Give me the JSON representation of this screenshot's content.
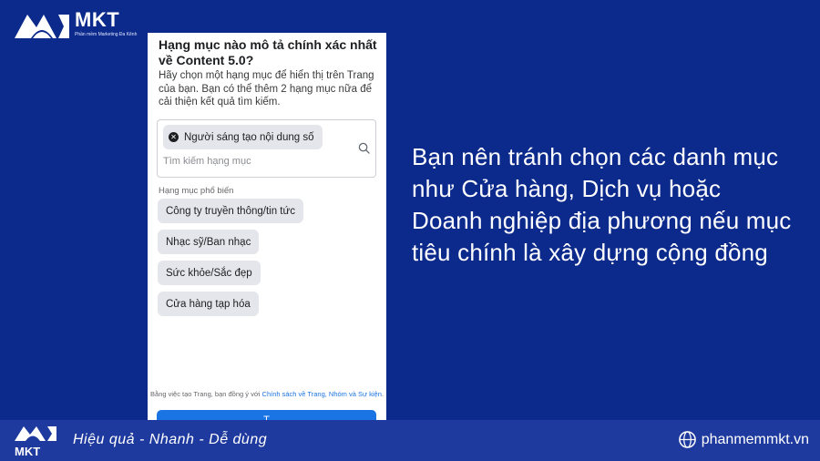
{
  "logo": {
    "brand": "MKT",
    "tagline": "Phần mềm Marketing Đa Kênh"
  },
  "panel": {
    "title": "Hạng mục nào mô tả chính xác nhất về Content 5.0?",
    "description": "Hãy chọn một hạng mục để hiển thị trên Trang của bạn. Bạn có thể thêm 2 hạng mục nữa để cải thiện kết quả tìm kiếm.",
    "selected_chip": "Người sáng tạo nội dung số",
    "search_placeholder": "Tìm kiếm hạng mục",
    "popular_title": "Hạng mục phổ biến",
    "categories": [
      "Công ty truyền thông/tin tức",
      "Nhạc sỹ/Ban nhạc",
      "Sức khỏe/Sắc đẹp",
      "Cửa hàng tạp hóa"
    ],
    "terms_prefix": "Bằng việc tạo Trang, bạn đồng ý với ",
    "terms_link": "Chính sách về Trang, Nhóm và Sự kiện",
    "terms_suffix": ".",
    "cta_label": "T"
  },
  "message": "Bạn nên tránh chọn các danh mục như Cửa hàng, Dịch vụ hoặc Doanh nghiệp địa phương nếu mục tiêu chính là xây dựng cộng đồng",
  "footer": {
    "slogan": "Hiệu quả - Nhanh  - Dễ dùng",
    "website": "phanmemmkt.vn",
    "bottom_brand": "MKT"
  },
  "colors": {
    "background": "#0c2a8c",
    "bottom_bar": "#1e3a9e",
    "accent": "#1b74e4"
  }
}
